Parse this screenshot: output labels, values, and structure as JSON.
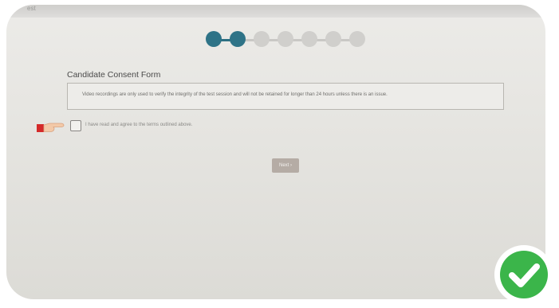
{
  "corner_label": "est",
  "stepper": {
    "total_steps": 7,
    "completed_steps": 2
  },
  "form": {
    "title": "Candidate Consent Form",
    "notice": "Video recordings are only used to verify the integrity of the test session and will not be retained for longer than 24 hours unless there is an issue.",
    "agree_label": "I have read and agree to the terms outlined above.",
    "checkbox_checked": false,
    "next_label": "Next ›"
  },
  "colors": {
    "step_active": "#2e7387",
    "step_inactive": "#d0cfcc",
    "pointer_red": "#d42a2a",
    "check_green": "#3bb54a",
    "next_button": "#b5aca5"
  },
  "icons": {
    "pointer": "pointing-hand-icon",
    "check": "check-circle-icon"
  }
}
